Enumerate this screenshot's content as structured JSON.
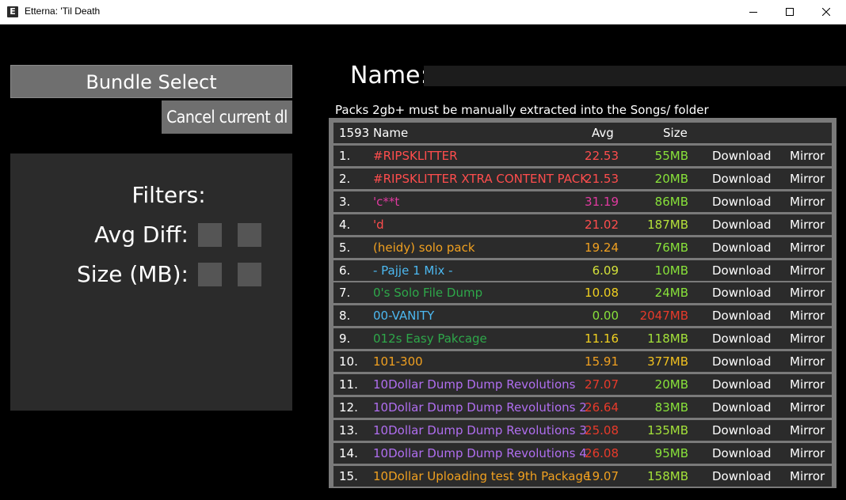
{
  "window": {
    "title": "Etterna: 'Til Death",
    "app_icon": "E"
  },
  "left": {
    "bundle_select": "Bundle Select",
    "cancel_download": "Cancel current dl",
    "filters_title": "Filters:",
    "avg_diff_label": "Avg Diff:",
    "size_label": "Size (MB):"
  },
  "name_label": "Name:",
  "notice": "Packs 2gb+ must be manually extracted into the Songs/ folder",
  "table": {
    "header": {
      "count": "1593",
      "name": "Name",
      "avg": "Avg",
      "size": "Size"
    },
    "download_label": "Download",
    "mirror_label": "Mirror",
    "rows": [
      {
        "idx": "1.",
        "name": "#RIPSKLITTER",
        "avg": "22.53",
        "size": "55MB",
        "name_color": "#ff4d4d",
        "avg_color": "#ff4d4d",
        "size_color": "#88e23a"
      },
      {
        "idx": "2.",
        "name": "#RIPSKLITTER XTRA CONTENT PACK",
        "avg": "21.53",
        "size": "20MB",
        "name_color": "#ff4d4d",
        "avg_color": "#ff4d4d",
        "size_color": "#88e23a"
      },
      {
        "idx": "3.",
        "name": "'c**t",
        "avg": "31.19",
        "size": "86MB",
        "name_color": "#e03aa0",
        "avg_color": "#e03aa0",
        "size_color": "#88e23a"
      },
      {
        "idx": "4.",
        "name": "'d",
        "avg": "21.02",
        "size": "187MB",
        "name_color": "#ff4d4d",
        "avg_color": "#ff4d4d",
        "size_color": "#b6e23a"
      },
      {
        "idx": "5.",
        "name": "(heidy) solo pack",
        "avg": "19.24",
        "size": "76MB",
        "name_color": "#f0a020",
        "avg_color": "#f0a020",
        "size_color": "#88e23a"
      },
      {
        "idx": "6.",
        "name": "- Pajje 1 Mix -",
        "avg": "6.09",
        "size": "10MB",
        "name_color": "#4cb8f0",
        "avg_color": "#d4e23a",
        "size_color": "#88e23a"
      },
      {
        "idx": "7.",
        "name": "0's Solo File Dump",
        "avg": "10.08",
        "size": "24MB",
        "name_color": "#2ea84a",
        "avg_color": "#f0d020",
        "size_color": "#88e23a"
      },
      {
        "idx": "8.",
        "name": "00-VANITY",
        "avg": "0.00",
        "size": "2047MB",
        "name_color": "#4cb8f0",
        "avg_color": "#88e23a",
        "size_color": "#e83a2a"
      },
      {
        "idx": "9.",
        "name": "012s Easy Pakcage",
        "avg": "11.16",
        "size": "118MB",
        "name_color": "#2ea84a",
        "avg_color": "#f0d020",
        "size_color": "#a4e23a"
      },
      {
        "idx": "10.",
        "name": "101-300",
        "avg": "15.91",
        "size": "377MB",
        "name_color": "#f0a020",
        "avg_color": "#f0a020",
        "size_color": "#f0c020"
      },
      {
        "idx": "11.",
        "name": "10Dollar Dump Dump Revolutions",
        "avg": "27.07",
        "size": "20MB",
        "name_color": "#b06ef0",
        "avg_color": "#e83a2a",
        "size_color": "#88e23a"
      },
      {
        "idx": "12.",
        "name": "10Dollar Dump Dump Revolutions 2",
        "avg": "26.64",
        "size": "83MB",
        "name_color": "#b06ef0",
        "avg_color": "#e83a2a",
        "size_color": "#88e23a"
      },
      {
        "idx": "13.",
        "name": "10Dollar Dump Dump Revolutions 3",
        "avg": "25.08",
        "size": "135MB",
        "name_color": "#b06ef0",
        "avg_color": "#e83a2a",
        "size_color": "#a4e23a"
      },
      {
        "idx": "14.",
        "name": "10Dollar Dump Dump Revolutions 4",
        "avg": "26.08",
        "size": "95MB",
        "name_color": "#b06ef0",
        "avg_color": "#e83a2a",
        "size_color": "#88e23a"
      },
      {
        "idx": "15.",
        "name": "10Dollar Uploading test 9th Package",
        "avg": "19.07",
        "size": "158MB",
        "name_color": "#f0a020",
        "avg_color": "#f0a020",
        "size_color": "#a4e23a"
      }
    ]
  }
}
